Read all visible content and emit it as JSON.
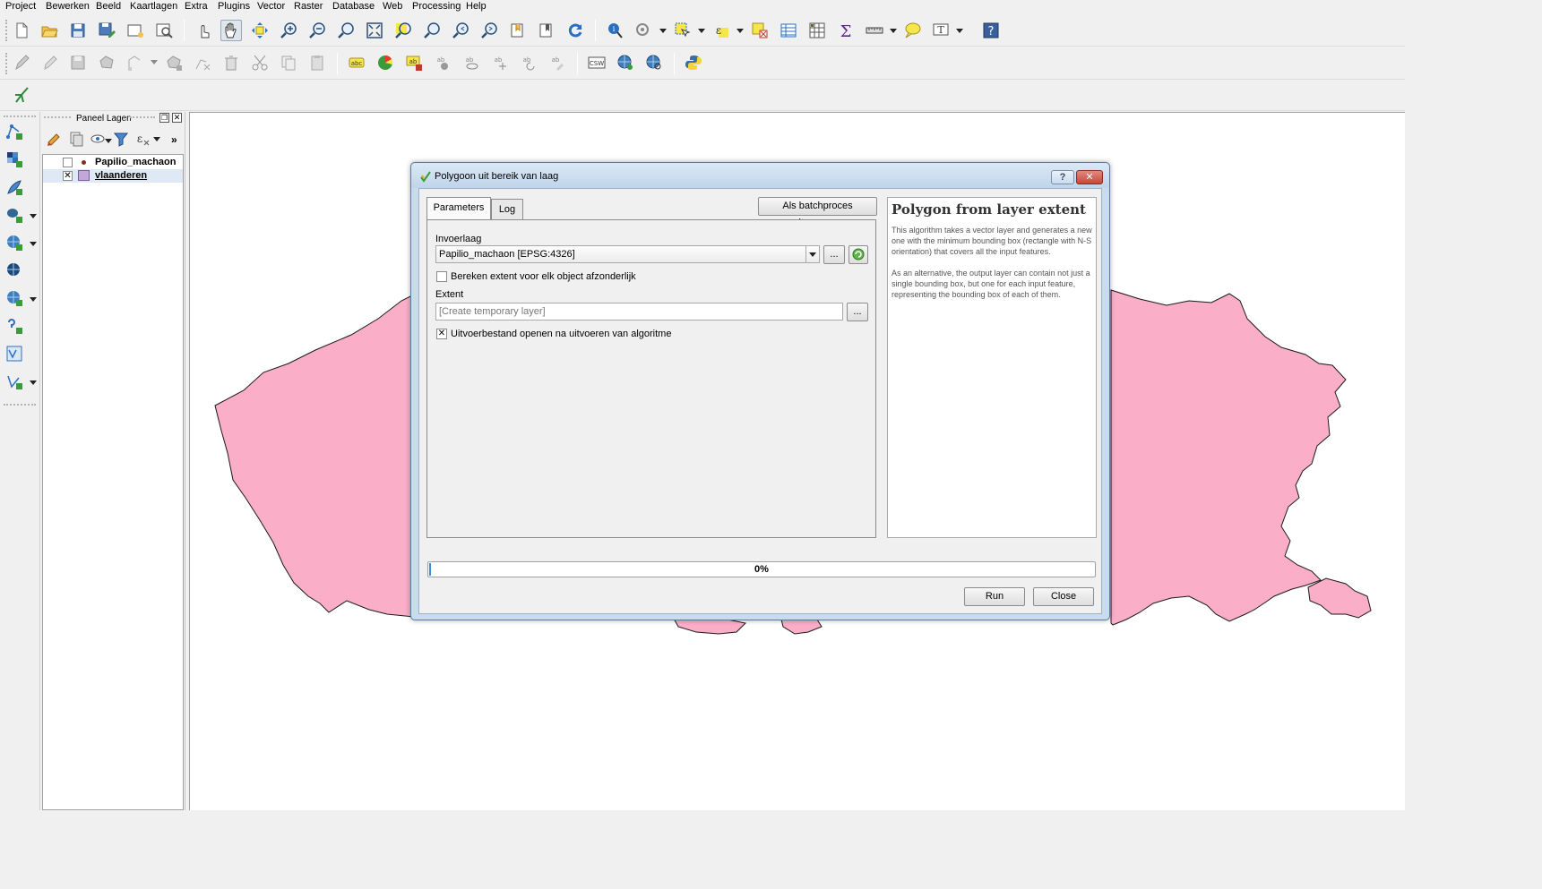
{
  "menu": [
    "Project",
    "Bewerken",
    "Beeld",
    "Kaartlagen",
    "Extra",
    "Plugins",
    "Vector",
    "Raster",
    "Database",
    "Web",
    "Processing",
    "Help"
  ],
  "colors": {
    "polygon_fill": "#fbaec8",
    "polygon_stroke": "#1a1a1a",
    "progress_fill": "#3c8fd8",
    "dialog_frame": "#c9dced",
    "close_button": "#c7483b"
  },
  "toolbar_icons": {
    "row1": [
      "new-project-icon",
      "open-project-icon",
      "save-project-icon",
      "save-as-icon",
      "new-print-composer-icon",
      "composer-manager-icon",
      "touch-zoom-pan-icon",
      "pan-map-icon",
      "pan-to-selection-icon",
      "zoom-in-icon",
      "zoom-out-icon",
      "zoom-actual-size-icon",
      "zoom-full-icon",
      "zoom-to-selection-icon",
      "zoom-to-layer-icon",
      "zoom-last-icon",
      "zoom-next-icon",
      "new-bookmark-icon",
      "show-bookmarks-icon",
      "refresh-icon",
      "identify-icon",
      "action-icon",
      "select-features-icon",
      "select-by-expression-icon",
      "deselect-icon",
      "attribute-table-icon",
      "field-calculator-icon",
      "statistics-icon",
      "measure-icon",
      "map-tips-icon",
      "text-annotation-icon",
      "help-icon"
    ],
    "row2": [
      "current-edits-icon",
      "toggle-editing-icon",
      "save-edits-icon",
      "add-feature-icon",
      "move-feature-icon",
      "node-tool-icon",
      "delete-selected-icon",
      "cut-features-icon",
      "copy-features-icon",
      "paste-features-icon",
      "label-icon",
      "diagram-icon",
      "layer-labeling-icon",
      "pin-labels-icon",
      "show-hide-labels-icon",
      "move-label-icon",
      "rotate-label-icon",
      "change-label-icon",
      "csw-icon",
      "metasearch-icon",
      "globe-search-icon",
      "python-console-icon"
    ],
    "row3": [
      "digitize-tool-icon"
    ]
  },
  "left_toolbar_icons": [
    "add-vector-layer-icon",
    "add-raster-layer-icon",
    "add-spatialite-layer-icon",
    "add-postgis-layer-icon",
    "add-wms-layer-icon",
    "add-wcs-layer-icon",
    "add-wfs-layer-icon",
    "add-delimited-text-icon",
    "add-virtual-layer-icon",
    "new-shapefile-icon"
  ],
  "layers_panel": {
    "title": "Paneel Lagen",
    "tool_icons": [
      "open-layer-styling-icon",
      "add-group-icon",
      "manage-visibility-icon",
      "filter-legend-icon",
      "filter-expression-icon",
      "expand-icon"
    ],
    "layers": [
      {
        "name": "Papilio_machaon",
        "checked": false,
        "symbol": "point"
      },
      {
        "name": "vlaanderen",
        "checked": true,
        "symbol": "polygon",
        "selected": true
      }
    ]
  },
  "dialog": {
    "title": "Polygoon uit bereik van laag",
    "tabs": [
      "Parameters",
      "Log"
    ],
    "batch_button": "Als batchproces uitvoeren...",
    "input_layer_label": "Invoerlaag",
    "input_layer_value": "Papilio_machaon [EPSG:4326]",
    "browse_label": "...",
    "per_feature_checkbox": {
      "label": "Bereken extent voor elk object afzonderlijk",
      "checked": false
    },
    "extent_label": "Extent",
    "extent_placeholder": "[Create temporary layer]",
    "open_output_checkbox": {
      "label": "Uitvoerbestand openen na uitvoeren van algoritme",
      "checked": true
    },
    "progress": {
      "value": 0,
      "text": "0%"
    },
    "run_button": "Run",
    "close_button": "Close",
    "help_button": "?",
    "help": {
      "title": "Polygon from layer extent",
      "paragraphs": [
        "This algorithm takes a vector layer and generates a new one with the minimum bounding box (rectangle with N-S orientation) that covers all the input features.",
        "As an alternative, the output layer can contain not just a single bounding box, but one for each input feature, representing the bounding box of each of them."
      ]
    }
  }
}
